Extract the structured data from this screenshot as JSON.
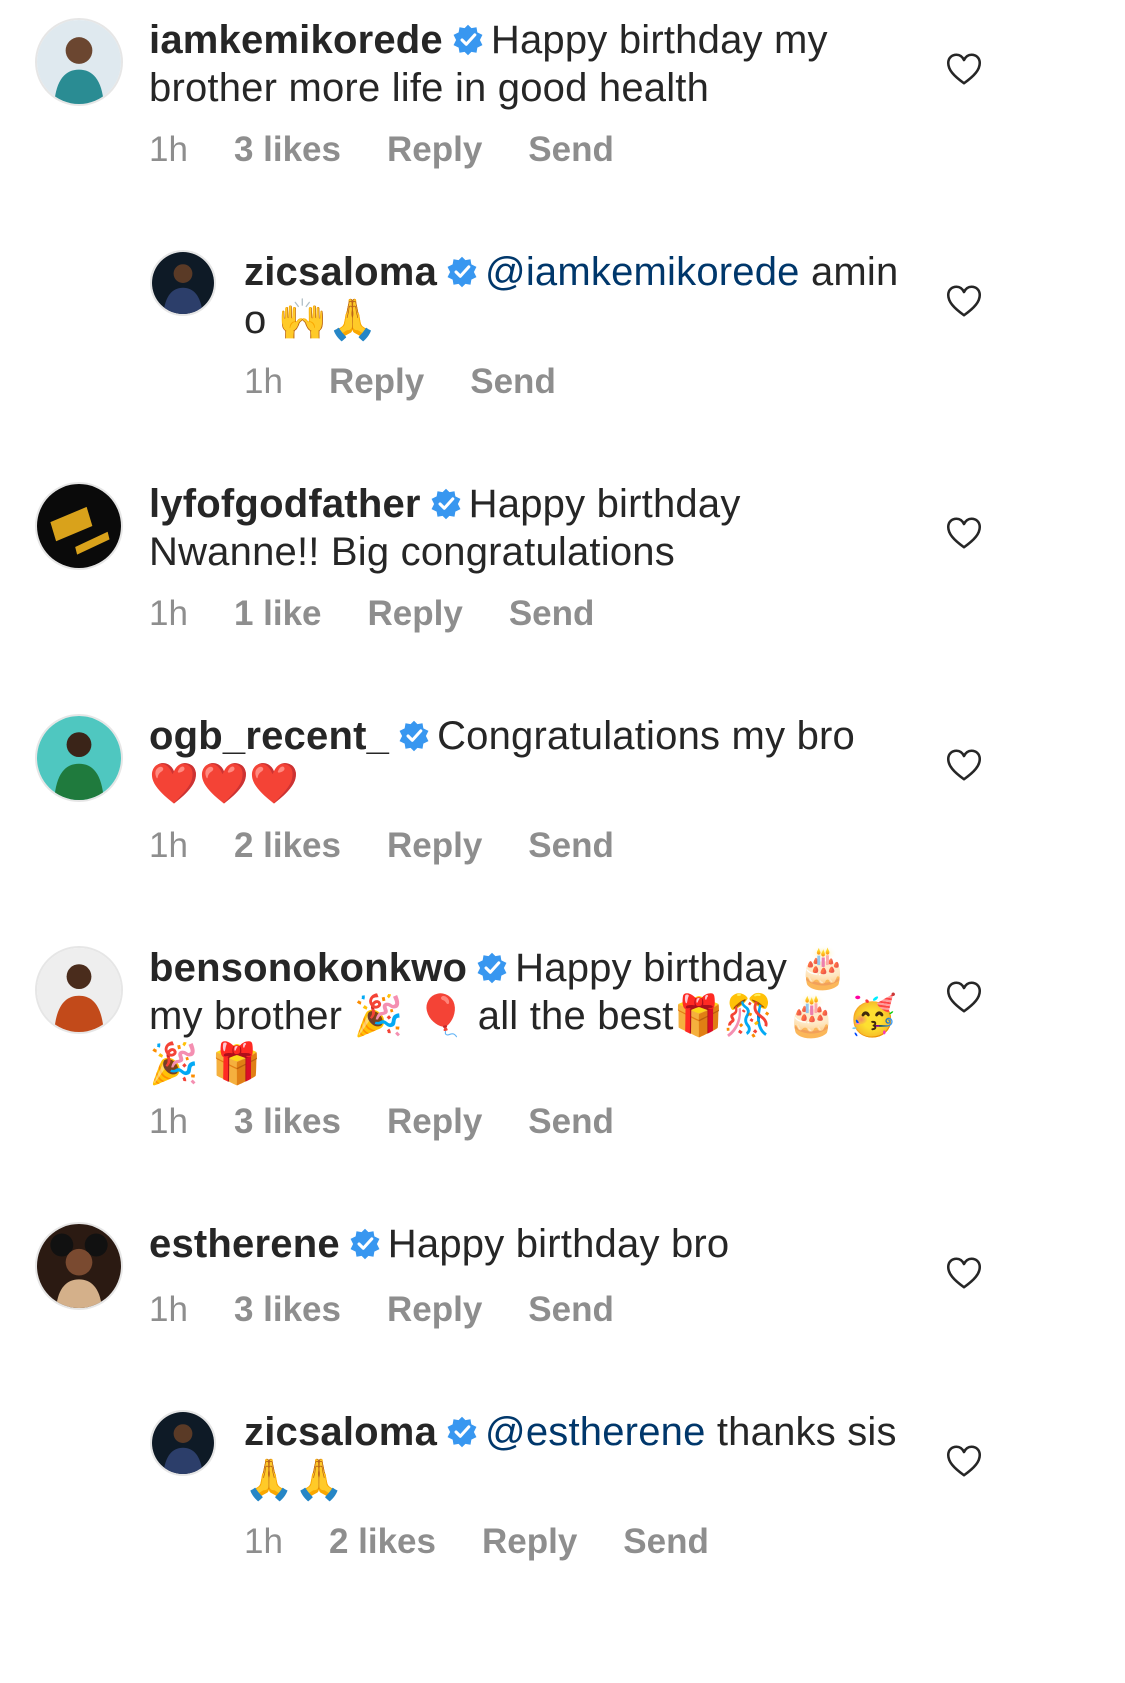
{
  "colors": {
    "username": "#262626",
    "meta": "#8e8e8e",
    "mention": "#00376b",
    "verified": "#3897f0"
  },
  "comments": [
    {
      "username": "iamkemikorede",
      "text": "Happy birthday my brother more life in good health",
      "time": "1h",
      "likes": "3 likes",
      "reply": "Reply",
      "send": "Send",
      "icons": [
        "avatar",
        "verified-badge-icon",
        "heart-icon"
      ]
    },
    {
      "username": "zicsaloma",
      "mention": "@iamkemikorede",
      "text": "amin o",
      "emoji": "🙌🙏",
      "time": "1h",
      "reply": "Reply",
      "send": "Send"
    },
    {
      "username": "lyfofgodfather",
      "text": "Happy birthday Nwanne!! Big congratulations",
      "time": "1h",
      "likes": "1 like",
      "reply": "Reply",
      "send": "Send"
    },
    {
      "username": "ogb_recent_",
      "text": "Congratulations my bro",
      "emoji": "❤️❤️❤️",
      "time": "1h",
      "likes": "2 likes",
      "reply": "Reply",
      "send": "Send"
    },
    {
      "username": "bensonokonkwo",
      "text_a": "Happy birthday",
      "emoji_a": "🎂",
      "text_b": "my brother",
      "emoji_b": "🎉 🎈",
      "text_c": "all the best",
      "emoji_c": "🎁🎊 🎂",
      "emoji_d": "🥳 🎉 🎁",
      "time": "1h",
      "likes": "3 likes",
      "reply": "Reply",
      "send": "Send"
    },
    {
      "username": "estherene",
      "text": "Happy birthday bro",
      "time": "1h",
      "likes": "3 likes",
      "reply": "Reply",
      "send": "Send"
    },
    {
      "username": "zicsaloma",
      "mention": "@estherene",
      "text": "thanks sis",
      "emoji": "🙏🙏",
      "time": "1h",
      "likes": "2 likes",
      "reply": "Reply",
      "send": "Send"
    }
  ]
}
